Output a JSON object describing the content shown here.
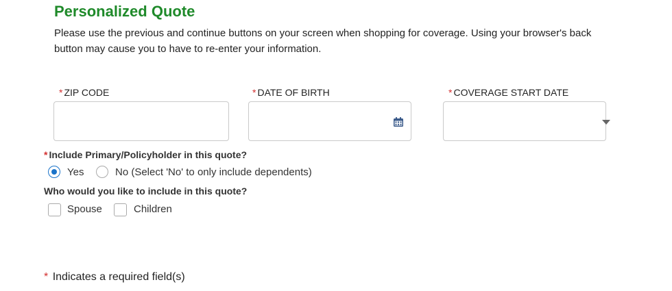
{
  "header": {
    "title": "Personalized Quote",
    "intro": "Please use the previous and continue buttons on your screen when shopping for coverage. Using your browser's back button may cause you to have to re-enter your information."
  },
  "form": {
    "required_marker": "*",
    "zip": {
      "label": "ZIP CODE",
      "value": ""
    },
    "dob": {
      "label": "DATE OF BIRTH",
      "value": "",
      "icon": "calendar-icon"
    },
    "coverage_start": {
      "label": "COVERAGE START DATE",
      "value": "",
      "icon": "chevron-down-icon"
    },
    "primary_question": {
      "label": "Include Primary/Policyholder in this quote?",
      "options": [
        {
          "label": "Yes",
          "selected": true
        },
        {
          "label": "No (Select 'No' to only include dependents)",
          "selected": false
        }
      ]
    },
    "include_question": {
      "label": "Who would you like to include in this quote?",
      "options": [
        {
          "label": "Spouse",
          "checked": false
        },
        {
          "label": "Children",
          "checked": false
        }
      ]
    }
  },
  "footer": {
    "required_note": "Indicates a required field(s)"
  },
  "colors": {
    "title_green": "#1f8a2a",
    "required_red": "#d32f2f",
    "radio_blue": "#1a73c9",
    "calendar_icon": "#3a5a8a"
  }
}
